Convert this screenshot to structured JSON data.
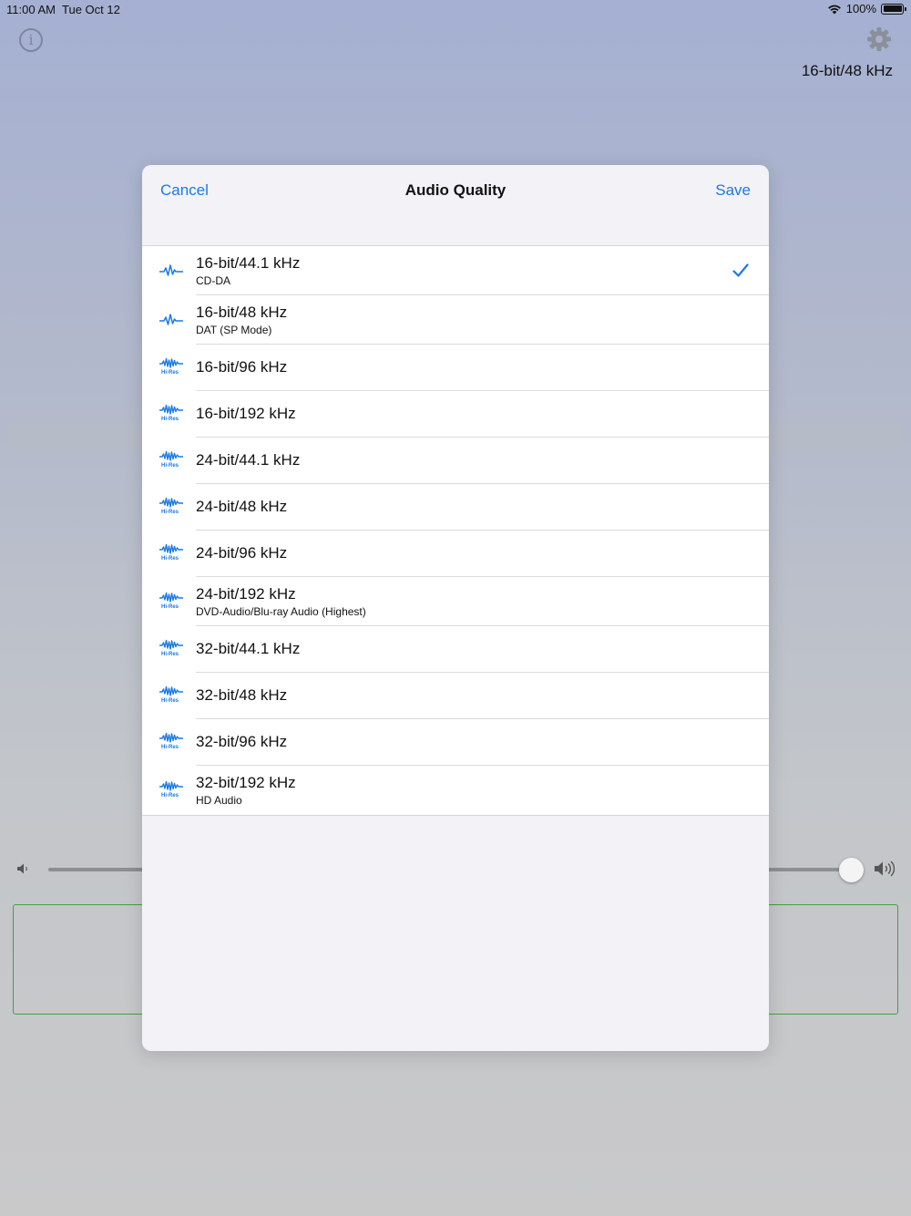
{
  "status_bar": {
    "time": "11:00 AM",
    "date": "Tue Oct 12",
    "battery": "100%"
  },
  "app": {
    "current_quality": "16-bit/48 kHz"
  },
  "modal": {
    "title": "Audio Quality",
    "cancel_label": "Cancel",
    "save_label": "Save",
    "options": [
      {
        "title": "16-bit/44.1 kHz",
        "subtitle": "CD-DA",
        "icon": "waveform-icon",
        "selected": true
      },
      {
        "title": "16-bit/48 kHz",
        "subtitle": "DAT (SP Mode)",
        "icon": "waveform-icon",
        "selected": false
      },
      {
        "title": "16-bit/96 kHz",
        "subtitle": "",
        "icon": "hi-res-icon",
        "selected": false
      },
      {
        "title": "16-bit/192 kHz",
        "subtitle": "",
        "icon": "hi-res-icon",
        "selected": false
      },
      {
        "title": "24-bit/44.1 kHz",
        "subtitle": "",
        "icon": "hi-res-icon",
        "selected": false
      },
      {
        "title": "24-bit/48 kHz",
        "subtitle": "",
        "icon": "hi-res-icon",
        "selected": false
      },
      {
        "title": "24-bit/96 kHz",
        "subtitle": "",
        "icon": "hi-res-icon",
        "selected": false
      },
      {
        "title": "24-bit/192 kHz",
        "subtitle": "DVD-Audio/Blu-ray Audio (Highest)",
        "icon": "hi-res-icon",
        "selected": false
      },
      {
        "title": "32-bit/44.1 kHz",
        "subtitle": "",
        "icon": "hi-res-icon",
        "selected": false
      },
      {
        "title": "32-bit/48 kHz",
        "subtitle": "",
        "icon": "hi-res-icon",
        "selected": false
      },
      {
        "title": "32-bit/96 kHz",
        "subtitle": "",
        "icon": "hi-res-icon",
        "selected": false
      },
      {
        "title": "32-bit/192 kHz",
        "subtitle": "HD Audio",
        "icon": "hi-res-icon",
        "selected": false
      }
    ],
    "hi_res_badge": "Hi-Res"
  },
  "volume": {
    "level": 1.0
  },
  "colors": {
    "accent": "#1a7ae6",
    "green_border": "#3fa33f"
  }
}
